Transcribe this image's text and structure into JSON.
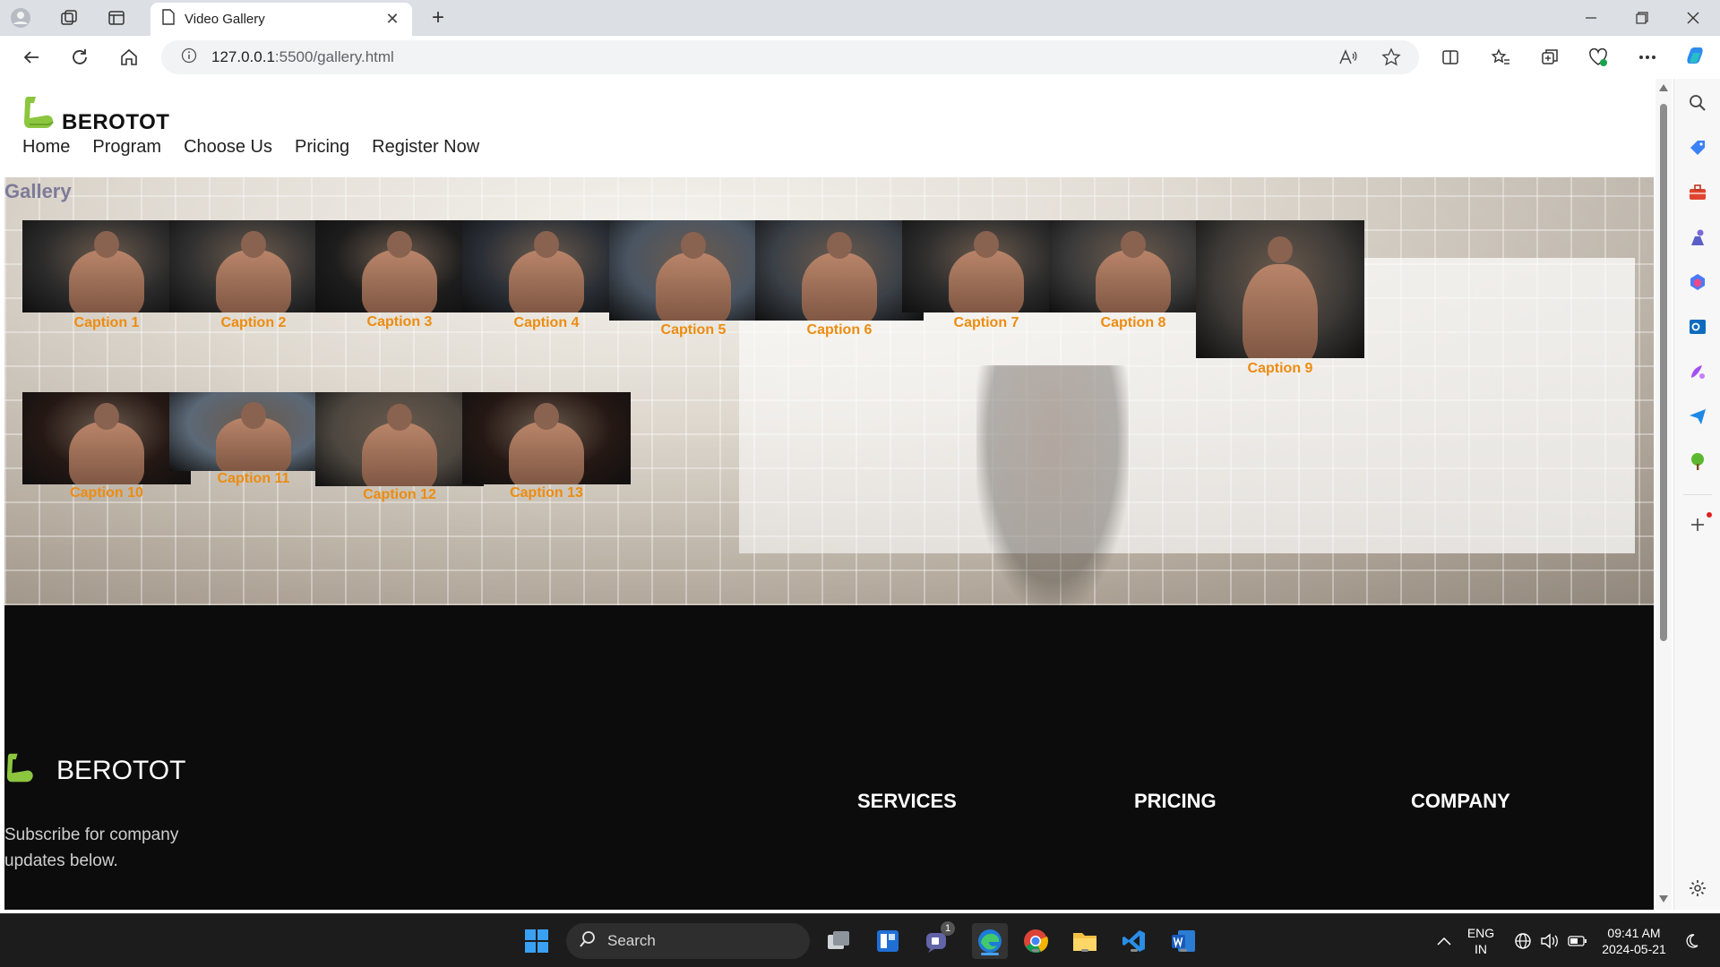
{
  "browser": {
    "tab_title": "Video Gallery",
    "url_host": "127.0.0.1",
    "url_path": ":5500/gallery.html",
    "close_symbol": "✕",
    "new_tab_symbol": "+"
  },
  "site": {
    "brand": "BEROTOT",
    "nav": [
      "Home",
      "Program",
      "Choose Us",
      "Pricing",
      "Register Now"
    ]
  },
  "gallery": {
    "title": "Gallery",
    "items": [
      {
        "caption": "Caption 1",
        "tone": "#2b2b2b"
      },
      {
        "caption": "Caption 2",
        "tone": "#303030"
      },
      {
        "caption": "Caption 3",
        "tone": "#1d1d1d"
      },
      {
        "caption": "Caption 4",
        "tone": "#2a2f36"
      },
      {
        "caption": "Caption 5",
        "tone": "#4a5562"
      },
      {
        "caption": "Caption 6",
        "tone": "#3b4148"
      },
      {
        "caption": "Caption 7",
        "tone": "#2c2c2c"
      },
      {
        "caption": "Caption 8",
        "tone": "#3a3a3a"
      },
      {
        "caption": "Caption 9",
        "tone": "#3d3a37"
      },
      {
        "caption": "Caption 10",
        "tone": "#251814"
      },
      {
        "caption": "Caption 11",
        "tone": "#5b6876"
      },
      {
        "caption": "Caption 12",
        "tone": "#4d4740"
      },
      {
        "caption": "Caption 13",
        "tone": "#251814"
      }
    ]
  },
  "footer": {
    "brand": "BEROTOT",
    "subscribe": "Subscribe for company updates below.",
    "columns": [
      "SERVICES",
      "PRICING",
      "COMPANY"
    ]
  },
  "taskbar": {
    "search_label": "Search",
    "lang_top": "ENG",
    "lang_bottom": "IN",
    "time": "09:41 AM",
    "date": "2024-05-21",
    "teams_badge": "1"
  },
  "colors": {
    "caption": "#ec8c10",
    "gallery_title": "#7e7a98",
    "logo_green": "#8cc63f",
    "footer_bg": "#0c0c0c"
  }
}
